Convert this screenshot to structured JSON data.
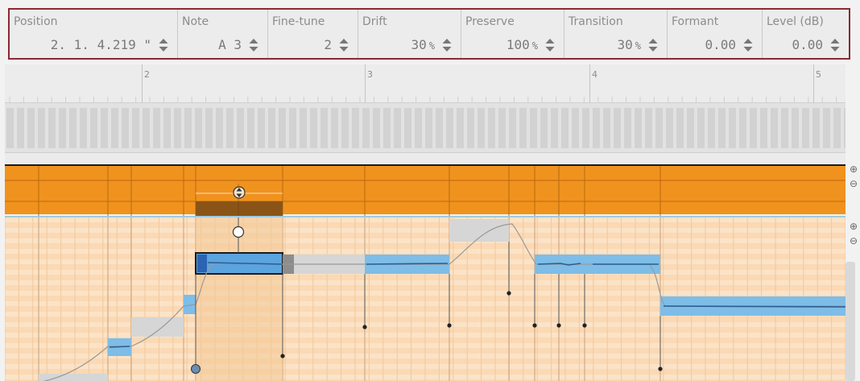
{
  "params": [
    {
      "id": "position",
      "label": "Position",
      "value": "2.  1.  4.219 \"",
      "unit": ""
    },
    {
      "id": "note",
      "label": "Note",
      "value": "A 3",
      "unit": ""
    },
    {
      "id": "finetune",
      "label": "Fine-tune",
      "value": "2",
      "unit": ""
    },
    {
      "id": "drift",
      "label": "Drift",
      "value": "30",
      "unit": "%"
    },
    {
      "id": "preserve",
      "label": "Preserve",
      "value": "100",
      "unit": "%"
    },
    {
      "id": "transition",
      "label": "Transition",
      "value": "30",
      "unit": "%"
    },
    {
      "id": "formant",
      "label": "Formant",
      "value": "0.00",
      "unit": ""
    },
    {
      "id": "level",
      "label": "Level (dB)",
      "value": "0.00",
      "unit": ""
    }
  ],
  "ruler": {
    "bars": [
      "2",
      "3",
      "4",
      "5"
    ]
  },
  "icons": {
    "spinner": "up-down-arrows-icon",
    "zoom_in": "zoom-in-icon",
    "zoom_out": "zoom-out-icon",
    "pitch_handle": "pitch-drag-handle-icon",
    "anchor": "anchor-handle-icon"
  },
  "colors": {
    "header_border": "#8a2a33",
    "overview_orange": "#f0921e",
    "grid_peach": "#fad9b4",
    "note_blue": "#7dbde8",
    "note_selected": "#2b74c2",
    "note_gray": "#d6d6d6"
  }
}
